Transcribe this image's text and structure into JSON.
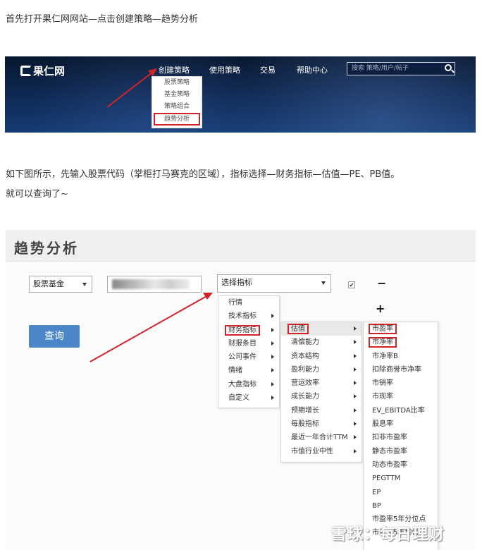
{
  "intro_text": "首先打开果仁网网站—点击创建策略—趋势分析",
  "site": {
    "logo": "果仁网",
    "nav": [
      "创建策略",
      "使用策略",
      "交易",
      "帮助中心"
    ],
    "search_placeholder": "搜索 策略/用户/帖子",
    "dropdown": [
      "股票策略",
      "基金策略",
      "策略组合",
      "趋势分析"
    ]
  },
  "instruction_text": "如下图所示，先输入股票代码（掌柜打马赛克的区域），指标选择—财务指标—估值—PE、PB值。",
  "instruction_text2": "就可以查询了~",
  "tool": {
    "title": "趋势分析",
    "type_select": "股票基金",
    "indicator_select": "选择指标",
    "checkbox_mark": "✔",
    "minus": "−",
    "plus": "+",
    "query_button": "查询",
    "menu1": [
      "行情",
      "技术指标",
      "财务指标",
      "财报条目",
      "公司事件",
      "情绪",
      "大盘指标",
      "自定义"
    ],
    "menu2": [
      "估值",
      "清偿能力",
      "资本结构",
      "盈利能力",
      "营运效率",
      "成长能力",
      "预期增长",
      "每股指标",
      "最近一年合计TTM",
      "市值行业中性"
    ],
    "menu3": [
      "市盈率",
      "市净率",
      "市净率B",
      "扣除商誉市净率",
      "市销率",
      "市现率",
      "EV_EBITDA比率",
      "股息率",
      "扣非市盈率",
      "静态市盈率",
      "动态市盈率",
      "PEGTTM",
      "EP",
      "BP",
      "市盈率5年分位点",
      "市盈率5年均值"
    ]
  },
  "watermark": "雪球：每日理财",
  "colors": {
    "highlight": "#d0232a",
    "button": "#4a86c8",
    "banner": "#0f2a55"
  }
}
